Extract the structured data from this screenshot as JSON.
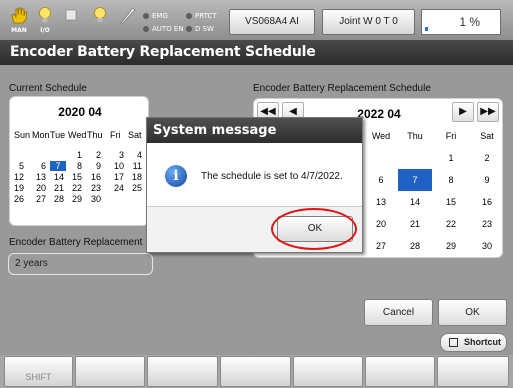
{
  "topbar": {
    "icons": [
      {
        "name": "hand-icon",
        "label": "MAN"
      },
      {
        "name": "bulb-icon",
        "label": "I/O"
      },
      {
        "name": "stop-icon",
        "label": ""
      },
      {
        "name": "lamp-icon",
        "label": ""
      },
      {
        "name": "wrench-icon",
        "label": ""
      }
    ],
    "leds": {
      "emg": "EMG",
      "prtct": "PRTCT",
      "auto_en": "AUTO EN",
      "dsw": "D SW"
    },
    "program_button": "VS068A4 AI",
    "joint_button": "Joint  W 0 T 0",
    "override": {
      "label": "1 %",
      "value_percent": 1
    }
  },
  "header": {
    "title": "Encoder Battery Replacement Schedule"
  },
  "current": {
    "section_label": "Current Schedule",
    "month_title": "2020 04",
    "weekday_headers": [
      "Sun",
      "Mon",
      "Tue",
      "Wed",
      "Thu",
      "Fri",
      "Sat"
    ],
    "weeks": [
      [
        "",
        "",
        "",
        "1",
        "2",
        "3",
        "4"
      ],
      [
        "5",
        "6",
        "7",
        "8",
        "9",
        "10",
        "11"
      ],
      [
        "12",
        "13",
        "14",
        "15",
        "16",
        "17",
        "18"
      ],
      [
        "19",
        "20",
        "21",
        "22",
        "23",
        "24",
        "25"
      ],
      [
        "26",
        "27",
        "28",
        "29",
        "30",
        "",
        ""
      ]
    ],
    "selected_day": "7"
  },
  "interval": {
    "label": "Encoder Battery Replacement",
    "value": "2 years"
  },
  "new_schedule": {
    "section_label": "Encoder Battery Replacement Schedule",
    "month_title": "2022 04",
    "nav": {
      "first": "◀◀",
      "prev": "◀",
      "next": "▶",
      "last": "▶▶"
    },
    "weekday_headers": [
      "Wed",
      "Thu",
      "Fri",
      "Sat"
    ],
    "weeks": [
      [
        "",
        "",
        "1",
        "2"
      ],
      [
        "6",
        "7",
        "8",
        "9"
      ],
      [
        "13",
        "14",
        "15",
        "16"
      ],
      [
        "20",
        "21",
        "22",
        "23"
      ],
      [
        "27",
        "28",
        "29",
        "30"
      ]
    ],
    "selected_day": "7"
  },
  "actions": {
    "cancel": "Cancel",
    "ok": "OK",
    "shortcut": "Shortcut"
  },
  "fkeys": [
    "SHIFT",
    "",
    "",
    "",
    "",
    "",
    ""
  ],
  "dialog": {
    "title": "System message",
    "message": "The schedule is set to 4/7/2022.",
    "ok": "OK",
    "highlight_color": "#e01414"
  },
  "colors": {
    "accent": "#1e63c4",
    "header": "#2b2b2b"
  }
}
